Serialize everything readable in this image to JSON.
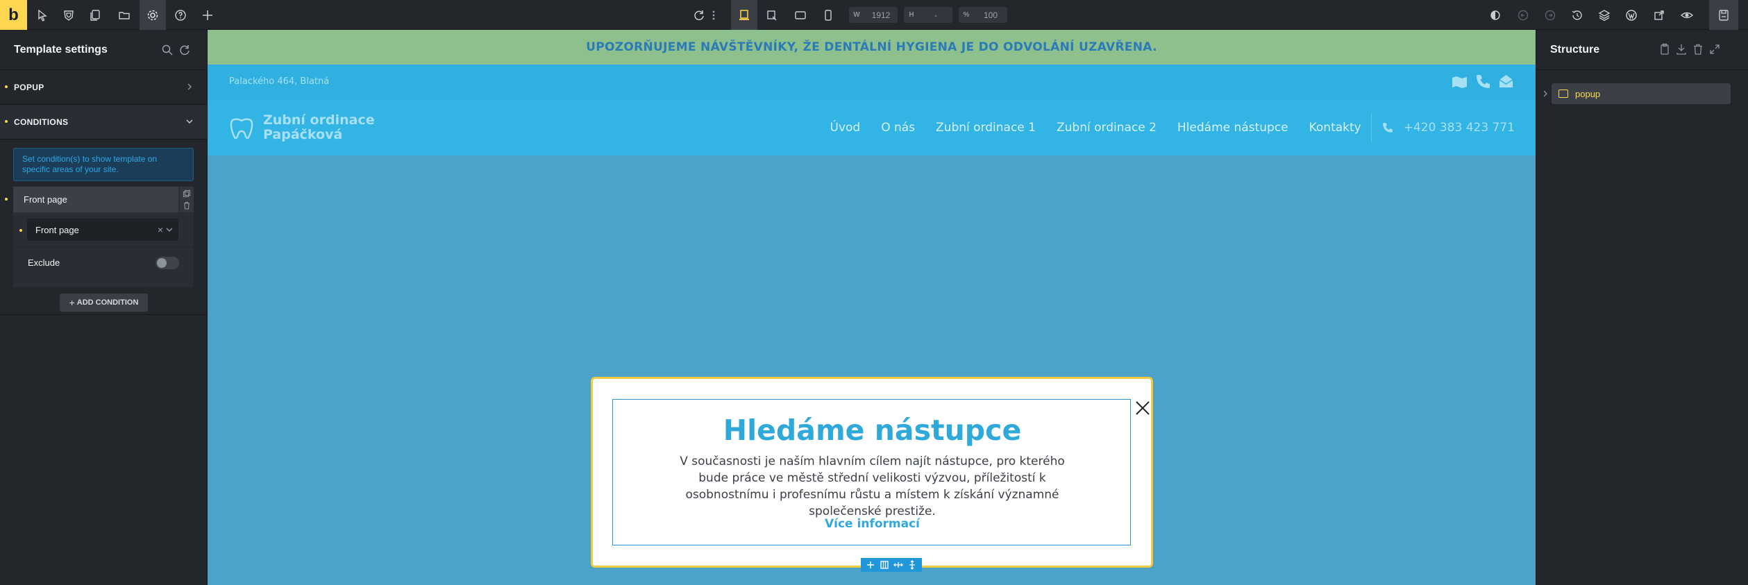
{
  "app": {
    "logo_letter": "b"
  },
  "toolbar": {
    "width_label": "W",
    "width_value": "1912",
    "height_label": "H",
    "height_value": "-",
    "zoom_label": "%",
    "zoom_value": "100"
  },
  "left_panel": {
    "title": "Template settings",
    "sections": [
      {
        "label": "POPUP"
      },
      {
        "label": "CONDITIONS"
      }
    ],
    "info_text": "Set condition(s) to show template on specific areas of your site.",
    "condition": {
      "header": "Front page",
      "select_value": "Front page",
      "exclude_label": "Exclude"
    },
    "add_condition_label": "ADD CONDITION"
  },
  "right_panel": {
    "title": "Structure",
    "items": [
      {
        "label": "popup"
      }
    ]
  },
  "site": {
    "notice": "UPOZORŇUJEME NÁVŠTĚVNÍKY, ŽE DENTÁLNÍ HYGIENA JE DO ODVOLÁNÍ UZAVŘENA.",
    "address": "Palackého 464, Blatná",
    "brand_line1": "Zubní ordinace",
    "brand_line2": "Papáčková",
    "nav": [
      "Úvod",
      "O nás",
      "Zubní ordinace 1",
      "Zubní ordinace 2",
      "Hledáme nástupce",
      "Kontakty"
    ],
    "phone": "+420 383 423 771"
  },
  "popup": {
    "title": "Hledáme nástupce",
    "text": "V současnosti je naším hlavním cílem najít nástupce, pro kterého bude práce ve městě střední velikosti výzvou, příležitostí k osobnostnímu i profesnímu růstu a místem k získání významné společenské prestiže.",
    "link": "Více informací"
  },
  "colors": {
    "brand_yellow": "#ffd64f",
    "site_blue": "#2fb0e0",
    "notice_green": "#8dc08c",
    "accent_blue": "#2fa9da"
  }
}
